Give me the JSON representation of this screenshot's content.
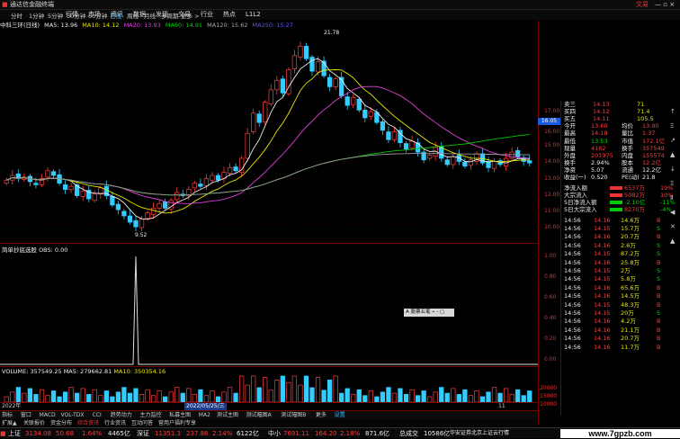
{
  "window": {
    "title": "通达信金融终端",
    "title_right": "文易",
    "win_btns": "— ▫ ×"
  },
  "menu": [
    "行情",
    "市场",
    "资讯",
    "数据",
    "发现",
    "交易",
    "行业",
    "热点",
    "L1L2"
  ],
  "periods": [
    "分时",
    "1分钟",
    "5分钟",
    "30分钟",
    "60分钟",
    "日线",
    "周线",
    "月线",
    "多周期",
    "更多 >"
  ],
  "chart_header": {
    "stock": "中科三环(日线)",
    "ma5": "MA5: 13.96",
    "ma10": "MA10: 14.12",
    "ma20": "MA20: 13.93",
    "ma60": "MA60: 14.91",
    "ma120": "MA120: 15.62",
    "ma250": "MA250: 15.27"
  },
  "price_axis": [
    "17.00",
    "16.00",
    "15.00",
    "14.00",
    "13.00",
    "12.00",
    "11.00",
    "10.00"
  ],
  "current_price_tag": "16.05",
  "annotations": {
    "high": "21.78",
    "low": "9.52"
  },
  "indicator": {
    "label": "简单抄底选股 OBS: 0.00",
    "axis": [
      "1.00",
      "0.80",
      "0.60",
      "0.40",
      "0.20",
      "0.00"
    ],
    "popup": "A 股票五笔 ⌁ - ▢"
  },
  "volume": {
    "label": "VOLUME: 357549.25",
    "ma5": "MA5: 279662.81",
    "ma10": "MA10: 350354.16",
    "axis": [
      "20000",
      "15000",
      "10000",
      "5000"
    ]
  },
  "date_axis": {
    "left": "2022年",
    "cursor": "2022/05/25/三",
    "right": "11"
  },
  "chart_data": {
    "type": "candlestick",
    "xlabel": "",
    "ylabel": "",
    "ylim": [
      9,
      22
    ],
    "close": [
      12.8,
      13.1,
      12.9,
      13.0,
      12.7,
      12.5,
      12.9,
      13.4,
      13.1,
      12.6,
      12.2,
      12.4,
      11.8,
      12.1,
      11.6,
      11.9,
      12.3,
      11.8,
      11.2,
      10.9,
      10.5,
      10.1,
      9.8,
      10.3,
      10.7,
      11.0,
      11.3,
      11.0,
      11.5,
      12.0,
      11.8,
      12.2,
      12.6,
      12.4,
      12.9,
      13.1,
      12.8,
      13.3,
      13.6,
      13.4,
      14.2,
      15.8,
      17.1,
      16.5,
      17.8,
      18.6,
      19.2,
      18.4,
      19.9,
      20.8,
      21.4,
      20.6,
      19.8,
      20.4,
      19.5,
      18.8,
      19.3,
      18.2,
      17.6,
      18.1,
      17.3,
      16.8,
      17.2,
      16.5,
      16.0,
      15.4,
      15.9,
      15.2,
      14.8,
      15.3,
      14.6,
      14.1,
      14.4,
      14.9,
      14.2,
      13.8,
      14.3,
      14.0,
      13.7,
      14.1,
      14.5,
      13.9,
      13.6,
      14.0,
      13.8,
      14.2,
      14.6,
      14.3,
      14.0,
      13.9
    ]
  },
  "quote": [
    {
      "l": "卖三",
      "p": "14.13",
      "v": "71"
    },
    {
      "l": "买四",
      "p": "14.12",
      "v": "71.4"
    },
    {
      "l": "买五",
      "p": "14.11",
      "v": "105.5"
    },
    {
      "l": "今开",
      "p": "13.60",
      "l2": "均价",
      "v": "13.90"
    },
    {
      "l": "最高",
      "p": "14.18",
      "l2": "量比",
      "v": "1.37"
    },
    {
      "l": "最低",
      "p": "13.53",
      "l2": "市值",
      "v": "172.1亿"
    },
    {
      "l": "现量",
      "p": "4162",
      "l2": "换手",
      "v": "357549"
    },
    {
      "l": "外盘",
      "p": "201975",
      "l2": "内盘",
      "v": "155574"
    },
    {
      "l": "换手",
      "p": "2.94%",
      "l2": "股本",
      "v": "12.2亿"
    },
    {
      "l": "净资",
      "p": "5.07",
      "l2": "流通",
      "v": "12.2亿"
    },
    {
      "l": "收益(一)",
      "p": "0.520",
      "l2": "PE(动)",
      "v": "21.8"
    }
  ],
  "flows": [
    {
      "l": "净流入额",
      "v": "6537万",
      "p": "19%"
    },
    {
      "l": "大宗流入",
      "v": "5082万",
      "p": "10%"
    },
    {
      "l": "5日净流入额",
      "v": "-2.10亿",
      "p": "-11%"
    },
    {
      "l": "5日大宗流入",
      "v": "8270万",
      "p": "-4%"
    }
  ],
  "ticks": [
    {
      "t": "14:56",
      "p": "14.16",
      "v": "14.6万",
      "f": "B"
    },
    {
      "t": "14:56",
      "p": "14.15",
      "v": "15.7万",
      "f": "S"
    },
    {
      "t": "14:56",
      "p": "14.16",
      "v": "20.7万",
      "f": "B"
    },
    {
      "t": "14:56",
      "p": "14.16",
      "v": "2.6万",
      "f": "S"
    },
    {
      "t": "14:56",
      "p": "14.15",
      "v": "87.2万",
      "f": "S"
    },
    {
      "t": "14:56",
      "p": "14.16",
      "v": "25.8万",
      "f": "B"
    },
    {
      "t": "14:56",
      "p": "14.15",
      "v": "2万",
      "f": "S"
    },
    {
      "t": "14:56",
      "p": "14.15",
      "v": "5.8万",
      "f": "S"
    },
    {
      "t": "14:56",
      "p": "14.16",
      "v": "65.6万",
      "f": "B"
    },
    {
      "t": "14:56",
      "p": "14.16",
      "v": "14.5万",
      "f": "B"
    },
    {
      "t": "14:56",
      "p": "14.15",
      "v": "48.3万",
      "f": "B"
    },
    {
      "t": "14:56",
      "p": "14.15",
      "v": "20万",
      "f": "S"
    },
    {
      "t": "14:56",
      "p": "14.16",
      "v": "4.2万",
      "f": "B"
    },
    {
      "t": "14:56",
      "p": "14.16",
      "v": "21.1万",
      "f": "B"
    },
    {
      "t": "14:56",
      "p": "14.16",
      "v": "20.7万",
      "f": "B"
    },
    {
      "t": "14:56",
      "p": "14.16",
      "v": "11.7万",
      "f": "B"
    }
  ],
  "sidebar_icons": [
    "↑",
    "Ξ",
    "↗",
    "▲",
    "↓",
    "Ξ",
    "Ⅱ",
    "◀",
    "✕",
    "▲"
  ],
  "bottom_tabs": [
    "指标",
    "窗口",
    "MACD",
    "VOL-TDX",
    "CCI",
    "趋势动力",
    "主力监控",
    "私募主图",
    "MA2",
    "测试主图",
    "测试幅图A",
    "测试幅图B",
    "更多",
    "设置"
  ],
  "bottom_tabs2": [
    "扩展▲",
    "关联报价",
    "资金分布",
    "综合资讯",
    "行业资讯",
    "互动问答",
    "营用户福利专享"
  ],
  "status": [
    {
      "name": "上证",
      "value": "3134.08",
      "change": "50.68",
      "pct": "1.64%",
      "vol": "4465亿"
    },
    {
      "name": "深证",
      "value": "11351.3",
      "change": "237.86",
      "pct": "2.14%",
      "vol": "6122亿"
    },
    {
      "name": "中小",
      "value": "7691.11",
      "change": "164.20",
      "pct": "2.18%",
      "vol": "871.6亿"
    }
  ],
  "status_extra": {
    "total_label": "总成交",
    "total": "10586亿",
    "news": "华安证券北京上证云行情"
  },
  "watermark": "www.7gpzb.com"
}
